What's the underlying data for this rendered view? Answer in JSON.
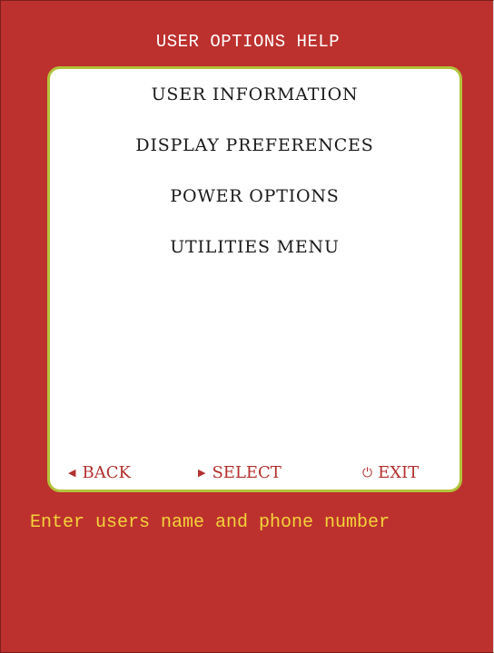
{
  "header": {
    "title": "USER OPTIONS HELP"
  },
  "menu": {
    "items": [
      {
        "label": "USER INFORMATION"
      },
      {
        "label": "DISPLAY PREFERENCES"
      },
      {
        "label": "POWER OPTIONS"
      },
      {
        "label": "UTILITIES MENU"
      }
    ]
  },
  "nav": {
    "back": {
      "icon": "triangle-left-icon",
      "glyph": "◀",
      "label": "BACK"
    },
    "select": {
      "icon": "triangle-right-icon",
      "glyph": "▶",
      "label": "SELECT"
    },
    "exit": {
      "icon": "power-icon",
      "glyph": "⏻",
      "label": "EXIT"
    }
  },
  "help": {
    "message": "Enter users name and phone number"
  },
  "colors": {
    "background": "#bc312e",
    "panel_border": "#b3c23a",
    "nav_text": "#b3302d",
    "message_text": "#f3d33a"
  }
}
